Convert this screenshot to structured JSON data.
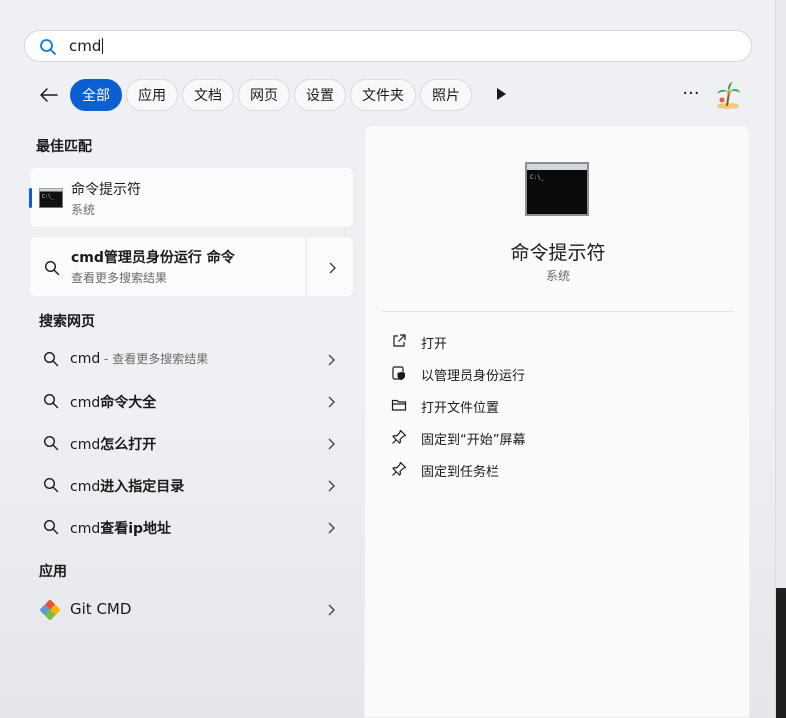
{
  "search": {
    "query": "cmd"
  },
  "filters": {
    "items": [
      "全部",
      "应用",
      "文档",
      "网页",
      "设置",
      "文件夹",
      "照片"
    ],
    "more": "···"
  },
  "best_match": {
    "section_title": "最佳匹配",
    "item": {
      "title": "命令提示符",
      "subtitle": "系统"
    },
    "run_admin": {
      "title": "cmd管理员身份运行 命令",
      "subtitle": "查看更多搜索结果"
    }
  },
  "web": {
    "section_title": "搜索网页",
    "items": [
      {
        "prefix": "cmd",
        "bold": "",
        "dim": " - 查看更多搜索结果"
      },
      {
        "prefix": "cmd",
        "bold": "命令大全",
        "dim": ""
      },
      {
        "prefix": "cmd",
        "bold": "怎么打开",
        "dim": ""
      },
      {
        "prefix": "cmd",
        "bold": "进入指定目录",
        "dim": ""
      },
      {
        "prefix": "cmd",
        "bold": "查看ip地址",
        "dim": ""
      }
    ]
  },
  "apps": {
    "section_title": "应用",
    "items": [
      {
        "title": "Git CMD"
      }
    ]
  },
  "preview": {
    "title": "命令提示符",
    "subtitle": "系统",
    "actions": [
      {
        "label": "打开",
        "icon": "open-external-icon"
      },
      {
        "label": "以管理员身份运行",
        "icon": "shield-icon"
      },
      {
        "label": "打开文件位置",
        "icon": "folder-icon"
      },
      {
        "label": "固定到“开始”屏幕",
        "icon": "pin-icon"
      },
      {
        "label": "固定到任务栏",
        "icon": "pin-icon"
      }
    ]
  },
  "colors": {
    "accent": "#0b5fd1"
  }
}
